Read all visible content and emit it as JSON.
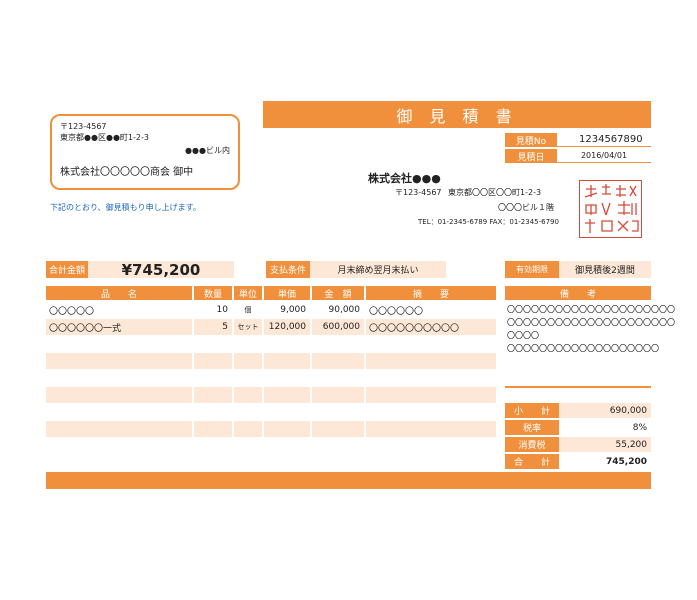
{
  "client": {
    "postal": "〒123-4567",
    "address": "東京都●●区●●町1-2-3",
    "building": "●●●ビル内",
    "name": "株式会社〇〇〇〇〇商会 御中"
  },
  "intro": "下記のとおり、御見積もり申し上げます。",
  "title": "御 見 積 書",
  "meta": {
    "number_label": "見積No",
    "number_value": "1234567890",
    "date_label": "見積日",
    "date_value": "2016/04/01"
  },
  "sender": {
    "company": "株式会社●●●",
    "postal": "〒123-4567",
    "address": "東京都〇〇区〇〇町1-2-3",
    "building": "〇〇〇ビル１階",
    "contact": "TEL：01-2345-6789  FAX：01-2345-6790"
  },
  "seal_text": "株式会社ポートサービス印",
  "summary": {
    "total_label": "合計金額",
    "total_value": "¥745,200",
    "payment_label": "支払条件",
    "payment_value": "月末締め翌月末払い",
    "validity_label": "有効期限",
    "validity_value": "御見積後2週間"
  },
  "table": {
    "headers": [
      "品　　名",
      "数量",
      "単位",
      "単価",
      "金　額",
      "摘　　要"
    ],
    "rows": [
      [
        "〇〇〇〇〇",
        "10",
        "個",
        "9,000",
        "90,000",
        "〇〇〇〇〇〇"
      ],
      [
        "〇〇〇〇〇〇一式",
        "5",
        "セット",
        "120,000",
        "600,000",
        "〇〇〇〇〇〇〇〇〇〇"
      ],
      [
        "",
        "",
        "",
        "",
        "",
        ""
      ],
      [
        "",
        "",
        "",
        "",
        "",
        ""
      ],
      [
        "",
        "",
        "",
        "",
        "",
        ""
      ],
      [
        "",
        "",
        "",
        "",
        "",
        ""
      ],
      [
        "",
        "",
        "",
        "",
        "",
        ""
      ],
      [
        "",
        "",
        "",
        "",
        "",
        ""
      ],
      [
        "",
        "",
        "",
        "",
        "",
        ""
      ]
    ]
  },
  "remarks": {
    "header": "備　　考",
    "lines": [
      "〇〇〇〇〇〇〇〇〇〇〇〇〇〇〇〇〇〇〇〇〇",
      "〇〇〇〇〇〇〇〇〇〇〇〇〇〇〇〇〇〇〇〇〇",
      "〇〇〇〇",
      "〇〇〇〇〇〇〇〇〇〇〇〇〇〇〇〇〇〇〇"
    ]
  },
  "totals": [
    {
      "label": "小　　計",
      "value": "690,000"
    },
    {
      "label": "税率",
      "value": "8%"
    },
    {
      "label": "消費税",
      "value": "55,200"
    },
    {
      "label": "合　　計",
      "value": "745,200"
    }
  ]
}
